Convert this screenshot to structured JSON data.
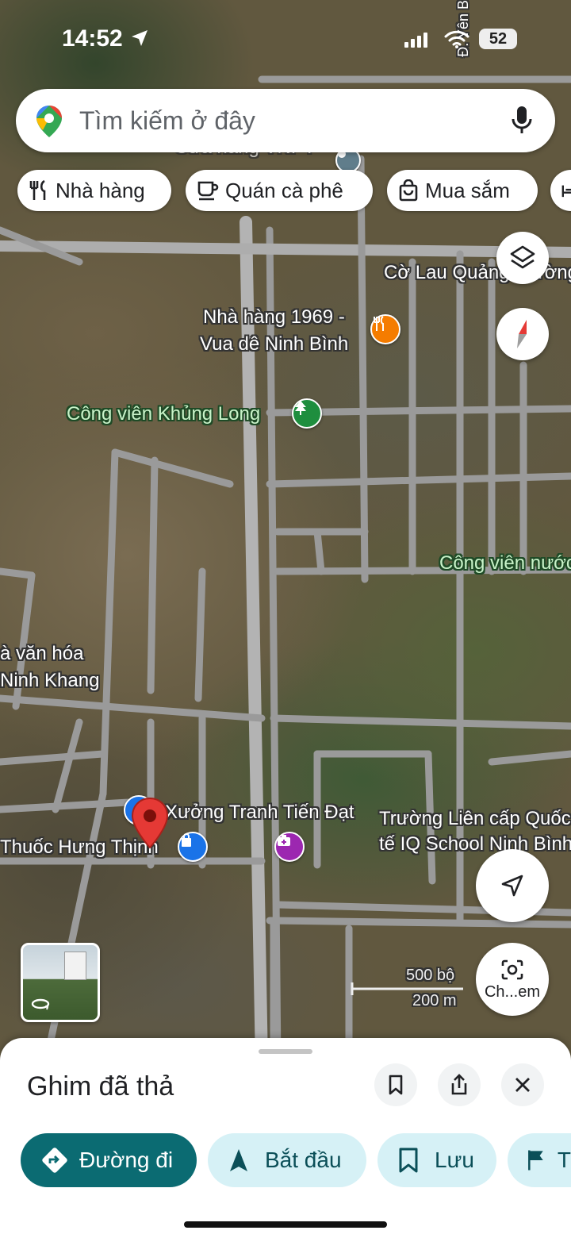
{
  "status_bar": {
    "time": "14:52",
    "battery": "52"
  },
  "search": {
    "placeholder": "Tìm kiếm ở đây",
    "mic_icon": "mic-icon",
    "logo_icon": "google-maps-pin-icon"
  },
  "chips": [
    {
      "label": "Nhà hàng",
      "icon": "restaurant-icon"
    },
    {
      "label": "Quán cà phê",
      "icon": "coffee-icon"
    },
    {
      "label": "Mua sắm",
      "icon": "shopping-bag-icon"
    }
  ],
  "map": {
    "labels": {
      "road_top": "Đ. Yên B",
      "top_obscured": "Cửa hàng VNPT",
      "co_lau": "Cờ Lau Quảng Trường",
      "restaurant_line1": "Nhà hàng 1969 -",
      "restaurant_line2": "Vua dê Ninh Bình",
      "park": "Công viên Khủng Long",
      "park_water": "Công viên nước",
      "culture_line1": "à văn hóa",
      "culture_line2": "Ninh Khang",
      "workshop": "Xưởng Tranh Tiến Đạt",
      "pharmacy": "Thuốc Hưng Thịnh",
      "school_line1": "Trường Liên cấp Quốc",
      "school_line2": "tế IQ School Ninh Bình",
      "scale_ft": "500 bộ",
      "scale_m": "200 m"
    },
    "camera_button_label": "Ch...em"
  },
  "sheet": {
    "title": "Ghim đã thả",
    "actions": [
      {
        "label": "Đường đi",
        "icon": "directions-icon",
        "primary": true
      },
      {
        "label": "Bắt đầu",
        "icon": "navigation-arrow-icon"
      },
      {
        "label": "Lưu",
        "icon": "bookmark-icon"
      },
      {
        "label": "T",
        "icon": "flag-icon"
      }
    ]
  },
  "colors": {
    "primary_teal": "#0b6b72",
    "chip_bg": "#ffffff",
    "pin_red": "#e53935",
    "secondary_bg": "#d6f1f6"
  }
}
